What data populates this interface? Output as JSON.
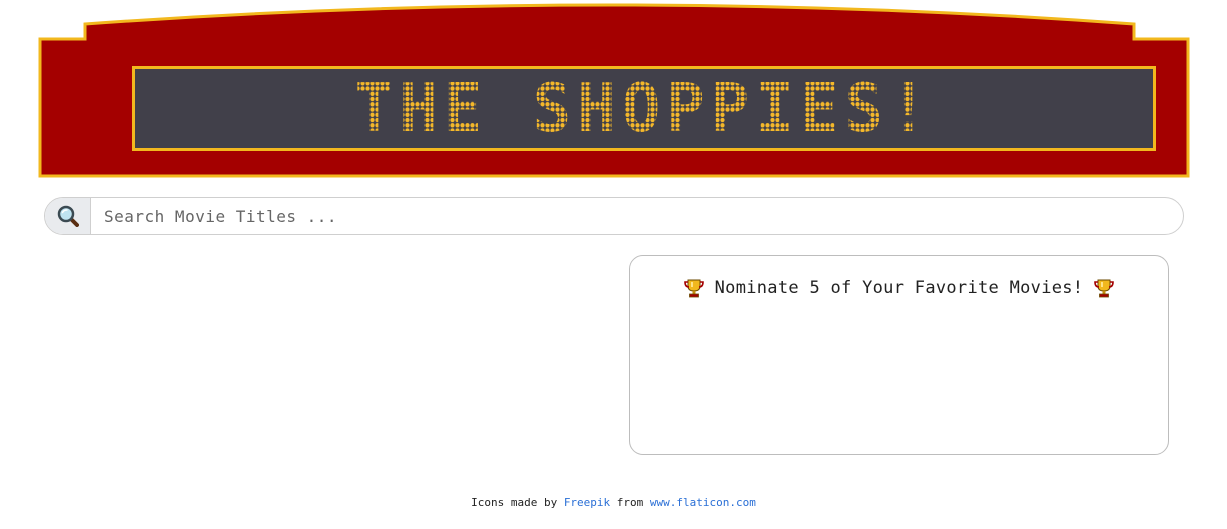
{
  "header": {
    "title": "THE SHOPPIES!",
    "colors": {
      "frame": "#a40000",
      "trim": "#f2b81e",
      "sign": "#41404a",
      "lights": "#f5b82a"
    }
  },
  "search": {
    "placeholder": "Search Movie Titles ...",
    "value": "",
    "icon": "magnifying-glass-icon"
  },
  "nominations": {
    "heading": "Nominate 5 of Your Favorite Movies!",
    "icon": "trophy-icon"
  },
  "footer": {
    "prefix": "Icons made by",
    "author": "Freepik",
    "middle": "from",
    "site": "www.flaticon.com",
    "link_color": "#2a6fd6"
  }
}
